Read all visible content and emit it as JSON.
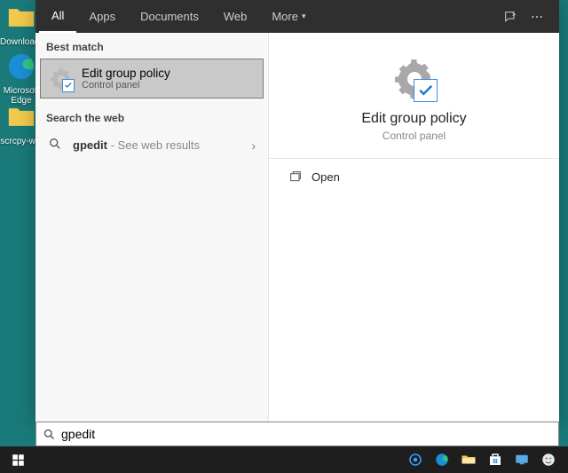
{
  "desktop": {
    "icons": [
      {
        "label": "Downloads"
      },
      {
        "label": "Microsoft Edge"
      },
      {
        "label": "scrcpy-win"
      }
    ]
  },
  "tabs": {
    "all": "All",
    "apps": "Apps",
    "documents": "Documents",
    "web": "Web",
    "more": "More"
  },
  "left": {
    "best_match_label": "Best match",
    "result": {
      "title": "Edit group policy",
      "subtitle": "Control panel"
    },
    "search_web_label": "Search the web",
    "web_result": {
      "term": "gpedit",
      "suffix": " - See web results"
    }
  },
  "detail": {
    "title": "Edit group policy",
    "subtitle": "Control panel",
    "open_label": "Open"
  },
  "search": {
    "value": "gpedit"
  }
}
